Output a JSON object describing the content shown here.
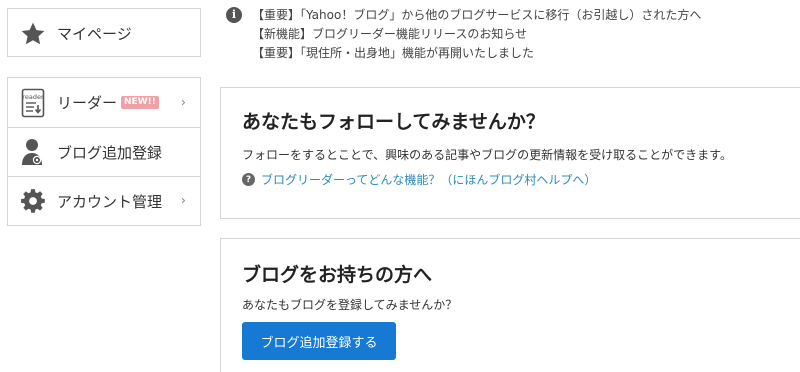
{
  "sidebar": {
    "mypage": {
      "label": "マイページ",
      "icon": "star-icon"
    },
    "items": [
      {
        "label": "リーダー",
        "badge": "NEW!!",
        "icon": "reader-icon",
        "chevron": "›"
      },
      {
        "label": "ブログ追加登録",
        "icon": "user-add-icon"
      },
      {
        "label": "アカウント管理",
        "icon": "gear-icon",
        "chevron": "›"
      }
    ]
  },
  "notices": [
    "【重要】「Yahoo！ブログ」から他のブログサービスに移行（お引越し）された方へ",
    "【新機能】ブログリーダー機能リリースのお知らせ",
    "【重要】「現住所・出身地」機能が再開いたしました"
  ],
  "follow_card": {
    "title": "あなたもフォローしてみませんか？",
    "text": "フォローをするとことで、興味のある記事やブログの更新情報を受け取ることができます。",
    "help_link": "ブログリーダーってどんな機能？（にほんブログ村ヘルプへ）"
  },
  "blog_card": {
    "title": "ブログをお持ちの方へ",
    "text": "あなたもブログを登録してみませんか？",
    "button": "ブログ追加登録する"
  },
  "colors": {
    "accent_blue": "#1679d4",
    "link": "#2d8bb8",
    "badge": "#f0a0a6"
  }
}
